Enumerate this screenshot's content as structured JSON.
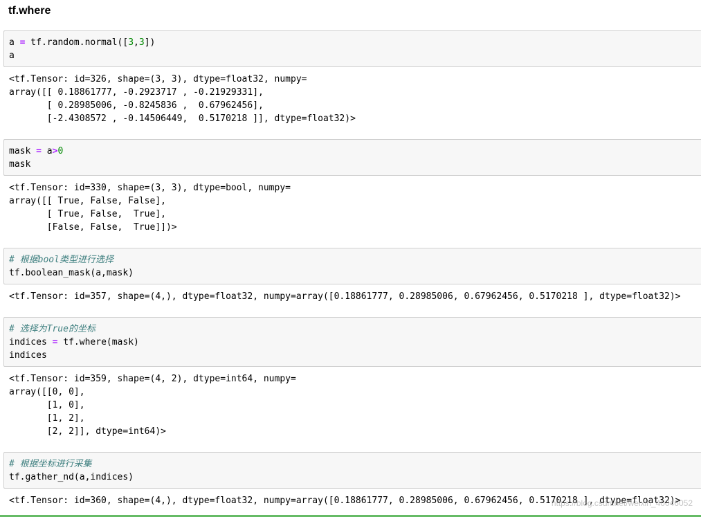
{
  "heading": "tf.where",
  "cells": [
    {
      "input": [
        {
          "parts": [
            {
              "t": "a "
            },
            {
              "t": "=",
              "c": "op"
            },
            {
              "t": " tf.random.normal(["
            },
            {
              "t": "3",
              "c": "num"
            },
            {
              "t": ","
            },
            {
              "t": "3",
              "c": "num"
            },
            {
              "t": "])"
            }
          ]
        },
        {
          "parts": [
            {
              "t": "a"
            }
          ]
        }
      ],
      "output": [
        "<tf.Tensor: id=326, shape=(3, 3), dtype=float32, numpy=",
        "array([[ 0.18861777, -0.2923717 , -0.21929331],",
        "       [ 0.28985006, -0.8245836 ,  0.67962456],",
        "       [-2.4308572 , -0.14506449,  0.5170218 ]], dtype=float32)>"
      ]
    },
    {
      "input": [
        {
          "parts": [
            {
              "t": "mask "
            },
            {
              "t": "=",
              "c": "op"
            },
            {
              "t": " a"
            },
            {
              "t": ">",
              "c": "op"
            },
            {
              "t": "0",
              "c": "num"
            }
          ]
        },
        {
          "parts": [
            {
              "t": "mask"
            }
          ]
        }
      ],
      "output": [
        "<tf.Tensor: id=330, shape=(3, 3), dtype=bool, numpy=",
        "array([[ True, False, False],",
        "       [ True, False,  True],",
        "       [False, False,  True]])>"
      ]
    },
    {
      "input": [
        {
          "parts": [
            {
              "t": "# 根据bool类型进行选择",
              "c": "cmt"
            }
          ]
        },
        {
          "parts": [
            {
              "t": "tf.boolean_mask(a,mask)"
            }
          ]
        }
      ],
      "output": [
        "<tf.Tensor: id=357, shape=(4,), dtype=float32, numpy=array([0.18861777, 0.28985006, 0.67962456, 0.5170218 ], dtype=float32)>"
      ]
    },
    {
      "input": [
        {
          "parts": [
            {
              "t": "# 选择为True的坐标",
              "c": "cmt"
            }
          ]
        },
        {
          "parts": [
            {
              "t": "indices "
            },
            {
              "t": "=",
              "c": "op"
            },
            {
              "t": " tf.where(mask)"
            }
          ]
        },
        {
          "parts": [
            {
              "t": "indices"
            }
          ]
        }
      ],
      "output": [
        "<tf.Tensor: id=359, shape=(4, 2), dtype=int64, numpy=",
        "array([[0, 0],",
        "       [1, 0],",
        "       [1, 2],",
        "       [2, 2]], dtype=int64)>"
      ]
    },
    {
      "input": [
        {
          "parts": [
            {
              "t": "# 根据坐标进行采集",
              "c": "cmt"
            }
          ]
        },
        {
          "parts": [
            {
              "t": "tf.gather_nd(a,indices)"
            }
          ]
        }
      ],
      "output": [
        "<tf.Tensor: id=360, shape=(4,), dtype=float32, numpy=array([0.18861777, 0.28985006, 0.67962456, 0.5170218 ], dtype=float32)>"
      ]
    }
  ],
  "watermark": "https://blog.csdn.net/weixin_40046052"
}
